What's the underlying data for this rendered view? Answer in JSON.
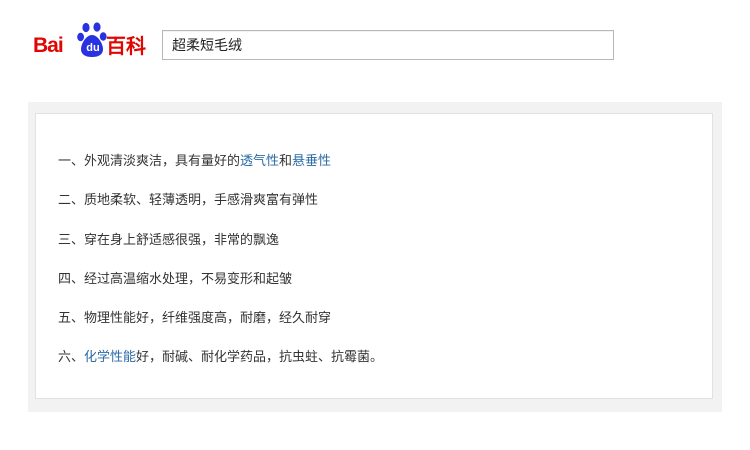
{
  "header": {
    "logo": {
      "text_bai": "Bai",
      "text_du": "du",
      "text_baike": "百科",
      "color": "#e10601"
    },
    "search": {
      "value": "超柔短毛绒"
    }
  },
  "features": [
    {
      "prefix": "一、外观清淡爽洁，具有量好的",
      "link1": "透气性",
      "middle": "和",
      "link2": "悬垂性",
      "suffix": ""
    },
    {
      "prefix": "二、质地柔软、轻薄透明，手感滑爽富有弹性",
      "link1": "",
      "middle": "",
      "link2": "",
      "suffix": ""
    },
    {
      "prefix": "三、穿在身上舒适感很强，非常的飘逸",
      "link1": "",
      "middle": "",
      "link2": "",
      "suffix": ""
    },
    {
      "prefix": "四、经过高温缩水处理，不易变形和起皱",
      "link1": "",
      "middle": "",
      "link2": "",
      "suffix": ""
    },
    {
      "prefix": "五、物理性能好，纤维强度高，耐磨，经久耐穿",
      "link1": "",
      "middle": "",
      "link2": "",
      "suffix": ""
    },
    {
      "prefix": "六、",
      "link1": "化学性能",
      "middle": "好，耐碱、耐化学药品，抗虫蛀、抗霉菌。",
      "link2": "",
      "suffix": ""
    }
  ],
  "colors": {
    "link": "#2a6aa6",
    "text": "#333333",
    "panel_bg": "#f2f2f2",
    "panel_border": "#e2e2e2"
  }
}
